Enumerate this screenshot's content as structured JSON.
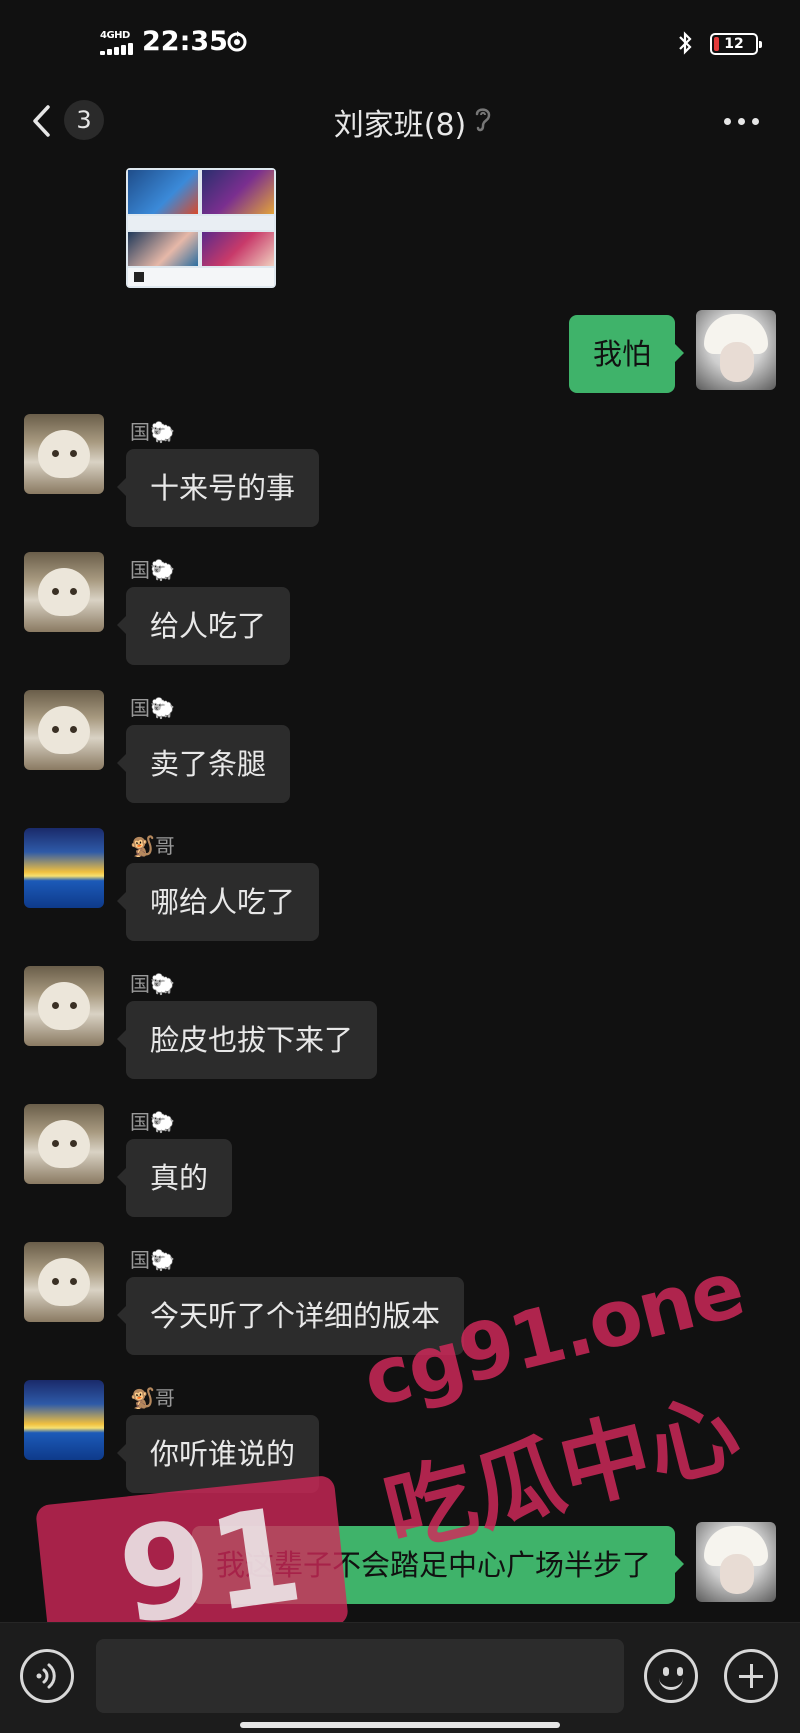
{
  "status_bar": {
    "network": "4GHD",
    "time": "22:35",
    "battery": "12",
    "battery_level_percent": 12,
    "icons": [
      "signal-icon",
      "sync-icon",
      "bluetooth-icon",
      "battery-icon"
    ]
  },
  "header": {
    "back_count": "3",
    "title": "刘家班(8)",
    "icons": [
      "back-arrow-icon",
      "earpiece-icon",
      "more-icon"
    ]
  },
  "messages": [
    {
      "sender": "",
      "text": "我怕",
      "mine": true
    },
    {
      "sender": "国🐑",
      "text": "十来号的事"
    },
    {
      "sender": "国🐑",
      "text": "给人吃了"
    },
    {
      "sender": "国🐑",
      "text": "卖了条腿"
    },
    {
      "sender": "🐒哥",
      "text": "哪给人吃了"
    },
    {
      "sender": "国🐑",
      "text": "脸皮也拔下来了"
    },
    {
      "sender": "国🐑",
      "text": "真的"
    },
    {
      "sender": "国🐑",
      "text": "今天听了个详细的版本"
    },
    {
      "sender": "🐒哥",
      "text": "你听谁说的"
    },
    {
      "sender": "",
      "text": "我这辈子不会踏足中心广场半步了",
      "mine": true
    }
  ],
  "watermark": {
    "number": "91",
    "domain": "cg91.one",
    "caption": "吃瓜中心"
  },
  "input_bar": {
    "placeholder": "",
    "icons": [
      "voice-icon",
      "emoji-icon",
      "plus-icon"
    ]
  },
  "colors": {
    "background": "#111111",
    "bubble_other": "#2c2c2c",
    "bubble_mine": "#3fb36a",
    "watermark": "#d2285a"
  }
}
